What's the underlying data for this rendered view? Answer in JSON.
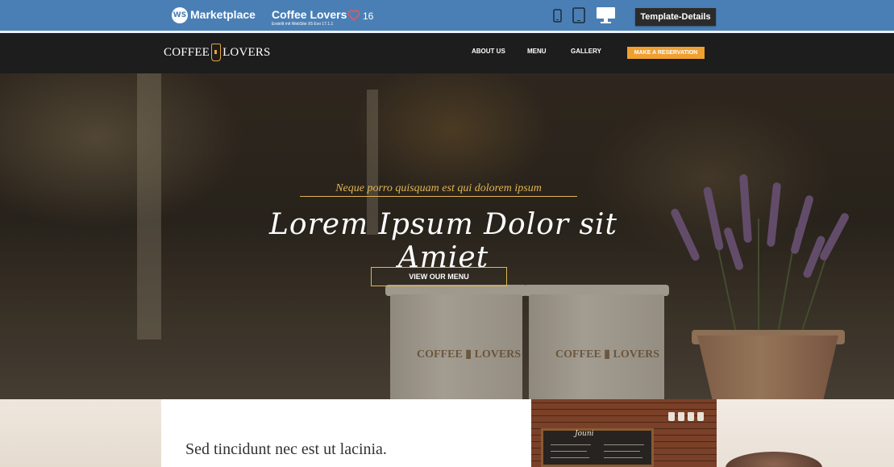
{
  "marketplace_bar": {
    "logo_mark": "WS",
    "logo_label": "Marketplace",
    "site_title": "Coffee Lovers",
    "site_subtitle": "Erstellt mit WebSite X5 Evo 17.1.1",
    "likes_count": "16",
    "device_icons": [
      "phone-icon",
      "tablet-icon",
      "desktop-icon"
    ],
    "active_device": "desktop",
    "template_button": "Template-Details",
    "colors": {
      "bar": "#4a7fb5",
      "button": "#2b2b2b",
      "heart": "#e05a5a"
    }
  },
  "site_header": {
    "brand_left": "COFFEE",
    "brand_right": "LOVERS",
    "nav": [
      "ABOUT US",
      "MENU",
      "GALLERY"
    ],
    "cta": "MAKE A RESERVATION",
    "colors": {
      "background": "#1d1d1d",
      "accent": "#f0a030"
    }
  },
  "hero": {
    "tagline": "Neque porro quisquam est qui dolorem ipsum",
    "title": "Lorem Ipsum Dolor sit Amiet",
    "button": "VIEW OUR MENU",
    "cup_logo_left": "COFFEE",
    "cup_logo_right": "LOVERS",
    "colors": {
      "gold": "#e2b553"
    }
  },
  "content": {
    "heading": "Sed tincidunt nec est ut lacinia.",
    "photo_board_title": "Jouni"
  }
}
